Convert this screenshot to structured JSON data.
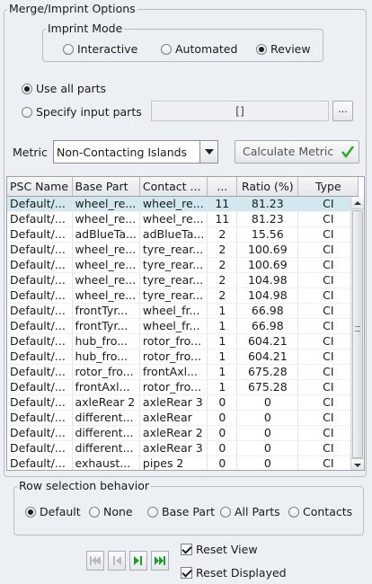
{
  "panel": {
    "title": "Merge/Imprint Options"
  },
  "imprint_mode": {
    "legend": "Imprint Mode",
    "options": [
      "Interactive",
      "Automated",
      "Review"
    ],
    "selected": "Review"
  },
  "parts": {
    "use_all_label": "Use all parts",
    "specify_label": "Specify input parts",
    "selected": "Use all parts",
    "input_value": "[]",
    "browse_label": "..."
  },
  "metric": {
    "label": "Metric",
    "selected": "Non-Contacting Islands",
    "calculate_label": "Calculate Metric"
  },
  "table": {
    "headers": [
      "PSC Name",
      "Base Part",
      "Contact ...",
      "...",
      "Ratio (%)",
      "Type"
    ],
    "rows": [
      [
        "Default/...",
        "wheel_re...",
        "wheel_re...",
        "11",
        "81.23",
        "CI"
      ],
      [
        "Default/...",
        "wheel_re...",
        "wheel_re...",
        "11",
        "81.23",
        "CI"
      ],
      [
        "Default/...",
        "adBlueTa...",
        "adBlueTa...",
        "2",
        "15.56",
        "CI"
      ],
      [
        "Default/...",
        "wheel_re...",
        "tyre_rear...",
        "2",
        "100.69",
        "CI"
      ],
      [
        "Default/...",
        "wheel_re...",
        "tyre_rear...",
        "2",
        "100.69",
        "CI"
      ],
      [
        "Default/...",
        "wheel_re...",
        "tyre_rear...",
        "2",
        "104.98",
        "CI"
      ],
      [
        "Default/...",
        "wheel_re...",
        "tyre_rear...",
        "2",
        "104.98",
        "CI"
      ],
      [
        "Default/...",
        "frontTyr...",
        "wheel_fr...",
        "1",
        "66.98",
        "CI"
      ],
      [
        "Default/...",
        "frontTyr...",
        "wheel_fr...",
        "1",
        "66.98",
        "CI"
      ],
      [
        "Default/...",
        "hub_fro...",
        "rotor_fro...",
        "1",
        "604.21",
        "CI"
      ],
      [
        "Default/...",
        "hub_fro...",
        "rotor_fro...",
        "1",
        "604.21",
        "CI"
      ],
      [
        "Default/...",
        "rotor_fro...",
        "frontAxl...",
        "1",
        "675.28",
        "CI"
      ],
      [
        "Default/...",
        "frontAxl...",
        "rotor_fro...",
        "1",
        "675.28",
        "CI"
      ],
      [
        "Default/...",
        "axleRear 2",
        "axleRear 3",
        "0",
        "0",
        "CI"
      ],
      [
        "Default/...",
        "different...",
        "axleRear",
        "0",
        "0",
        "CI"
      ],
      [
        "Default/...",
        "different...",
        "axleRear 2",
        "0",
        "0",
        "CI"
      ],
      [
        "Default/...",
        "different...",
        "axleRear 3",
        "0",
        "0",
        "CI"
      ],
      [
        "Default/...",
        "exhaust...",
        "pipes 2",
        "0",
        "0",
        "CI"
      ]
    ],
    "selected_row": 0
  },
  "row_selection": {
    "legend": "Row selection behavior",
    "options": [
      "Default",
      "None",
      "Base Part",
      "All Parts",
      "Contacts"
    ],
    "selected": "Default"
  },
  "footer": {
    "reset_view_label": "Reset View",
    "reset_view_checked": true,
    "reset_displayed_label": "Reset Displayed",
    "reset_displayed_checked": true
  },
  "colors": {
    "selected_row": "#d2e8ee",
    "check_green": "#2aa82a",
    "nav_green": "#1f9a2e"
  }
}
